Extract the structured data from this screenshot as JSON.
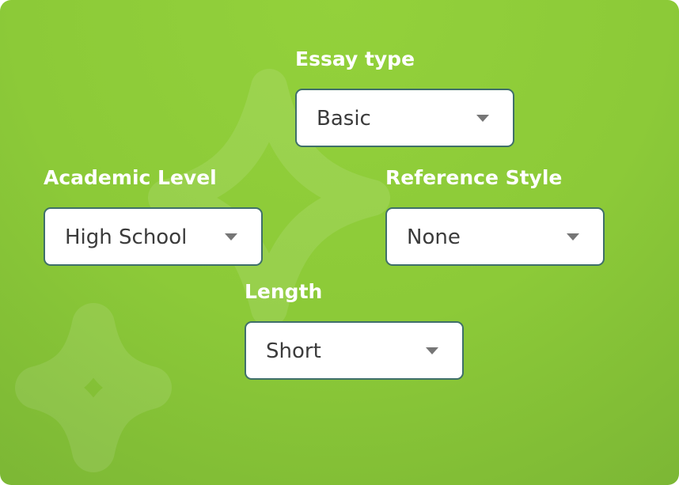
{
  "colors": {
    "background": "#8cca38",
    "field_border": "#3f6f6a",
    "label_text": "#ffffff",
    "value_text": "#3b3b3b",
    "caret": "#767676"
  },
  "fields": {
    "essay_type": {
      "label": "Essay type",
      "value": "Basic",
      "icon": "chevron-down-icon"
    },
    "academic_level": {
      "label": "Academic Level",
      "value": "High School",
      "icon": "chevron-down-icon"
    },
    "reference_style": {
      "label": "Reference Style",
      "value": "None",
      "icon": "chevron-down-icon"
    },
    "length": {
      "label": "Length",
      "value": "Short",
      "icon": "chevron-down-icon"
    }
  }
}
